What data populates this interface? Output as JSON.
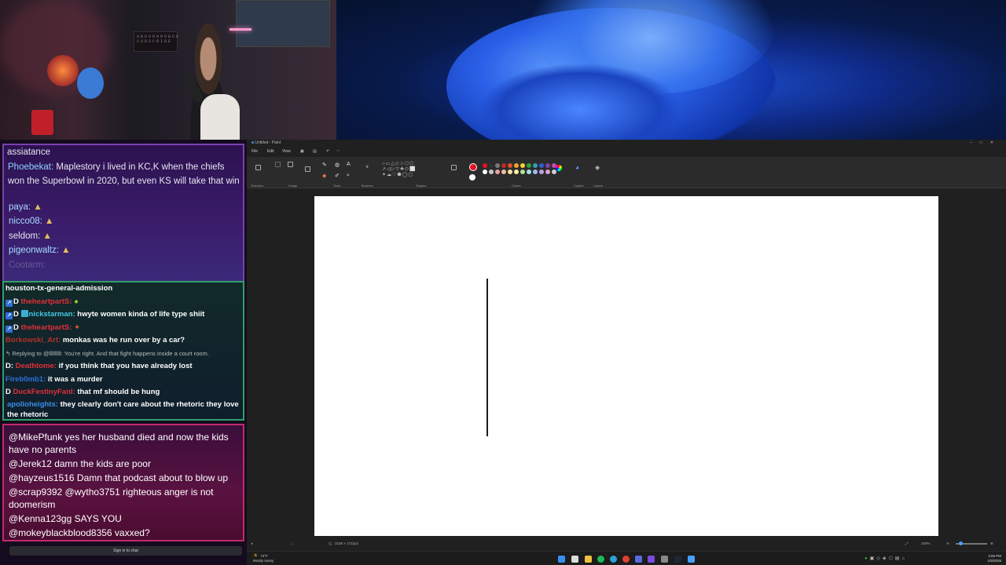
{
  "chat_top": {
    "lines": [
      {
        "user": "",
        "text": "assiatance"
      },
      {
        "user": "Phoebekat:",
        "text": "Maplestory i lived in KC,K when the chiefs won the Superbowl in 2020, but even KS will take that win"
      },
      {
        "user": "paya:",
        "text": ""
      },
      {
        "user": "nicco08:",
        "text": ""
      },
      {
        "user": "seldom:",
        "text": ""
      },
      {
        "user": "pigeonwaltz:",
        "text": ""
      }
    ],
    "faded": "Cootarm:"
  },
  "chat_mid": {
    "header": "houston-tx-general-admission",
    "lines": [
      {
        "user": "theheartpartS:",
        "text": "",
        "color": "#e0303a"
      },
      {
        "user": "nickstarman:",
        "text": "hwyte women kinda of life type shiit",
        "color": "#43c6e0"
      },
      {
        "user": "theheartpartS:",
        "text": "",
        "color": "#e0303a"
      },
      {
        "user": "Borkowski_Art:",
        "text": "monkas was he run over by a car?",
        "color": "#b0302a"
      },
      {
        "user": "",
        "text": "Replying to @lllllllll: You're right. And that fight happens inside a court room.",
        "color": "#aaa"
      },
      {
        "user": "Deathtome:",
        "text": "if you think that you have already lost",
        "color": "#e0303a"
      },
      {
        "user": "Fireb0mb1:",
        "text": "it was a murder",
        "color": "#2f6fd8"
      },
      {
        "user": "DuckFestinyFanl:",
        "text": "that mf should be hung",
        "color": "#e0303a"
      },
      {
        "user": "apolloheights:",
        "text": "they clearly don't care about the rhetoric they love the rhetoric",
        "color": "#3a8ee6"
      }
    ]
  },
  "chat_bottom": {
    "lines": [
      "@MikePfunk yes her husband died and now the kids have no parents",
      "@Jerek12 damn the kids are poor",
      "@hayzeus1516 Damn that podcast about to blow up",
      "@scrap9392 @wytho3751 righteous anger is not doomerism",
      "@Kenna123gg SAYS YOU",
      "@mokeyblackblood8356 vaxxed?"
    ],
    "signin_label": "Sign in to chat"
  },
  "paint": {
    "title": "Untitled - Paint",
    "menu": [
      "File",
      "Edit",
      "View"
    ],
    "groups": [
      "Selection",
      "Image",
      "Tools",
      "Brushes",
      "Shapes",
      "Colors",
      "Copilot",
      "Layers"
    ],
    "status_size": "3158 × 1722px",
    "zoom": "100%",
    "colors": [
      "#e81123",
      "#303030",
      "#7a7a7a",
      "#c8281e",
      "#e05030",
      "#f0a030",
      "#f8d030",
      "#30a040",
      "#30a0b0",
      "#3060d0",
      "#8040b0",
      "#c050a0"
    ]
  },
  "taskbar": {
    "weather_temp": "74°F",
    "weather_desc": "Mostly sunny",
    "time": "3:06 PM",
    "date": "1/9/2026"
  }
}
